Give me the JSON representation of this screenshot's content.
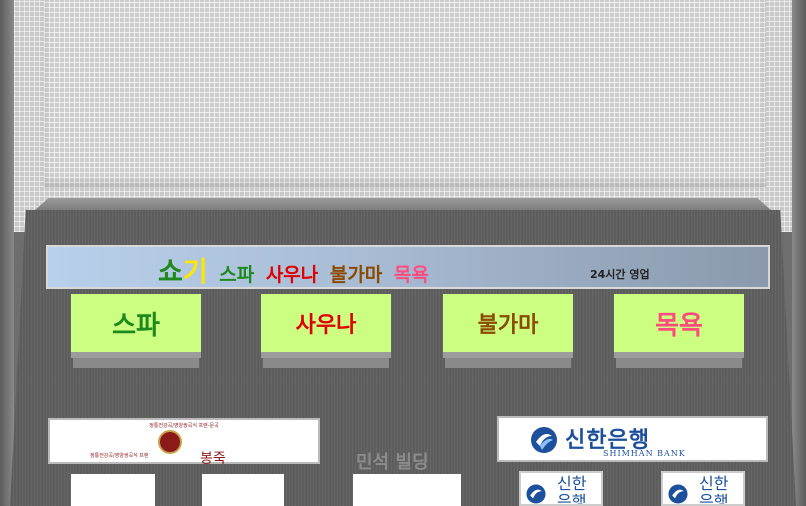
{
  "banner": {
    "brand_part1": "쇼",
    "brand_part2": "기",
    "item1": "스파",
    "item2": "사우나",
    "item3": "불가마",
    "item4": "목욕",
    "hours": "24시간 영업"
  },
  "buttons": [
    {
      "label": "스파"
    },
    {
      "label": "사우나"
    },
    {
      "label": "불가마"
    },
    {
      "label": "목욕"
    }
  ],
  "left_sign": {
    "top_text": "정통전강곡/영양쌍곡식 프랜-문곡",
    "bottom_text": "정통전강곡/영양쌍곡식 프랜",
    "brand": "봉죽"
  },
  "building_name": "민석 빌딩",
  "bank_sign": {
    "name_kr": "신한은행",
    "name_en": "SHIMHAN BANK"
  },
  "atms": [
    {
      "label": "신한",
      "label2": "은행"
    },
    {
      "label": "신한",
      "label2": "은행"
    }
  ],
  "colors": {
    "button_bg": "#ccfe82",
    "spa_text": "#1e8a1e",
    "sauna_text": "#e00000",
    "bulgama_text": "#8b4a00",
    "mokyok_text": "#ff4b7d",
    "bank_blue": "#1c4f9c"
  }
}
